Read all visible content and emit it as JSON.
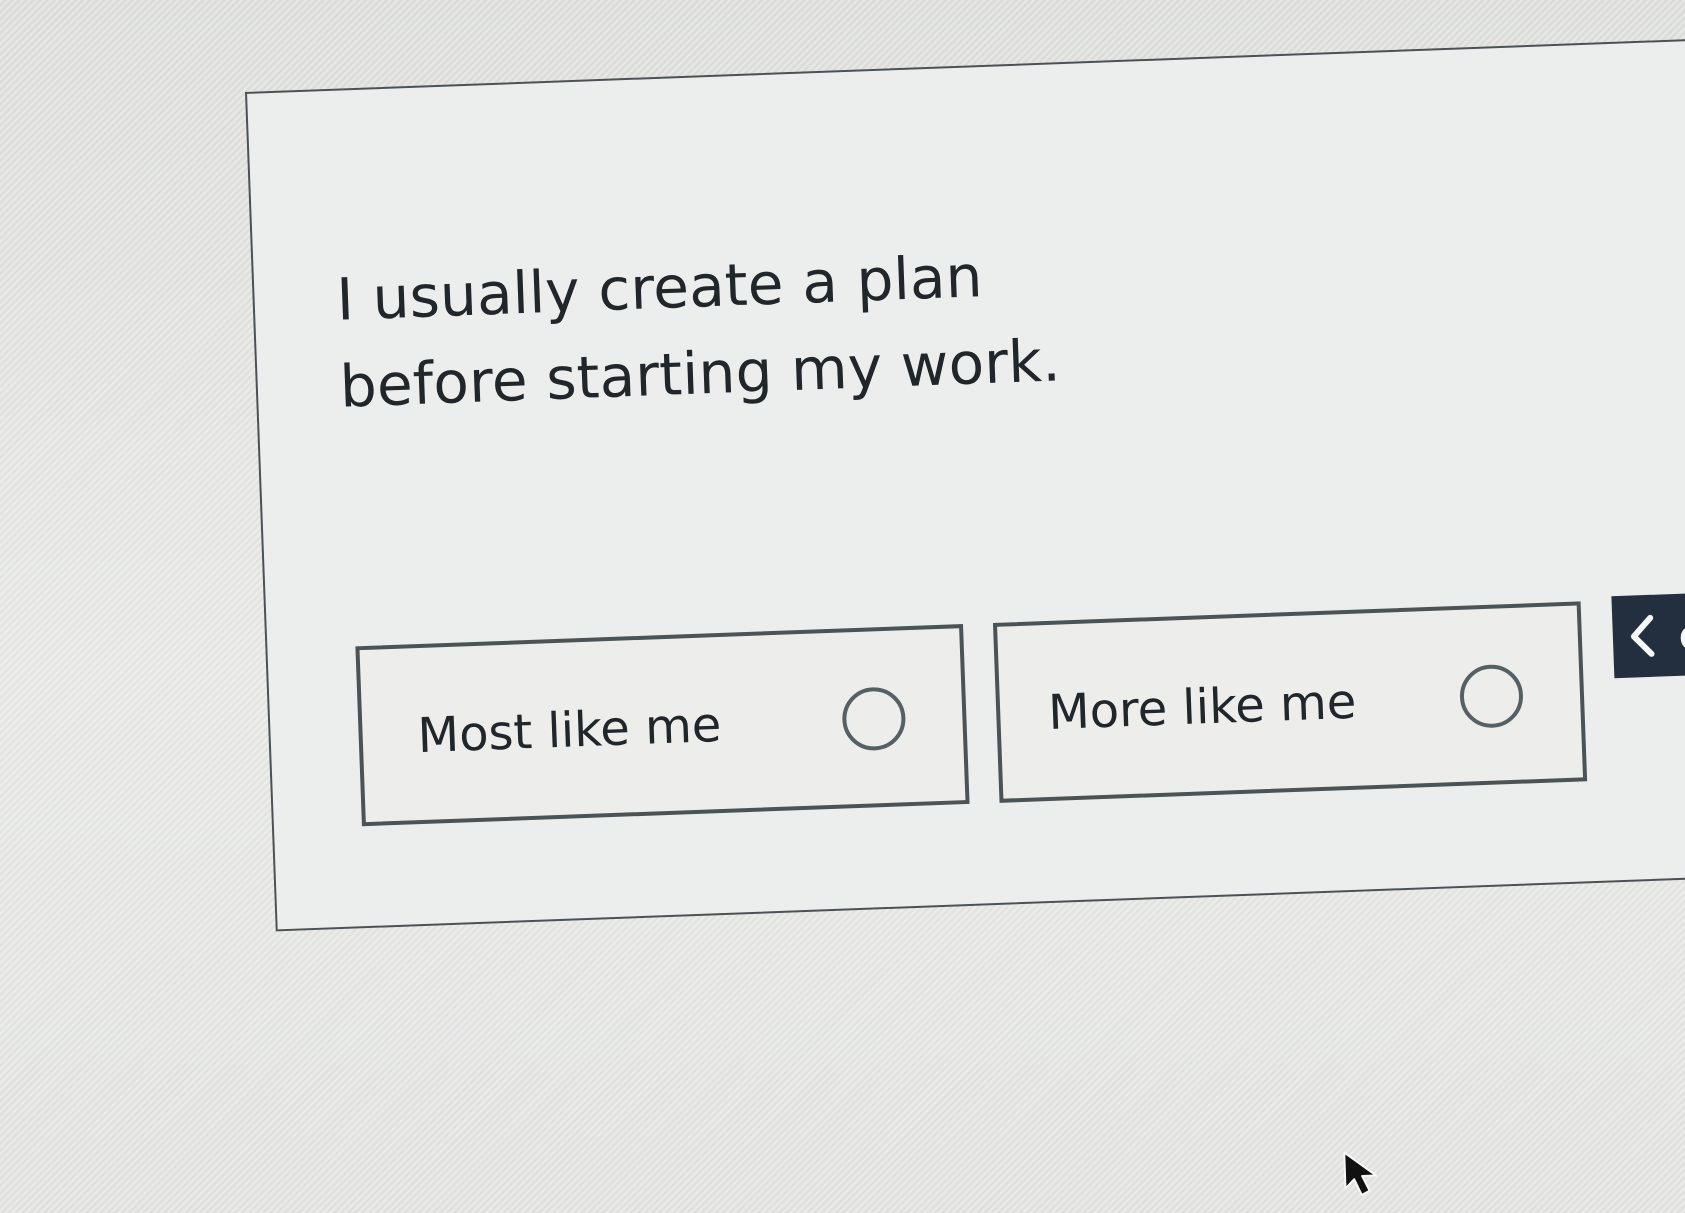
{
  "question": {
    "text": "I usually create a plan before starting my work."
  },
  "options": [
    {
      "label": "Most like me",
      "icon": "radio-empty-icon",
      "selected": false
    },
    {
      "label": "More like me",
      "icon": "radio-empty-icon",
      "selected": false
    }
  ],
  "navigation": {
    "back_icon": "chevron-left-icon",
    "visible_label": "or"
  },
  "pointer": {
    "icon": "mouse-pointer-icon"
  },
  "colors": {
    "border": "#4b5356",
    "text": "#20262a",
    "nav_background": "#232f3e",
    "page_background": "#e6e7e5"
  }
}
